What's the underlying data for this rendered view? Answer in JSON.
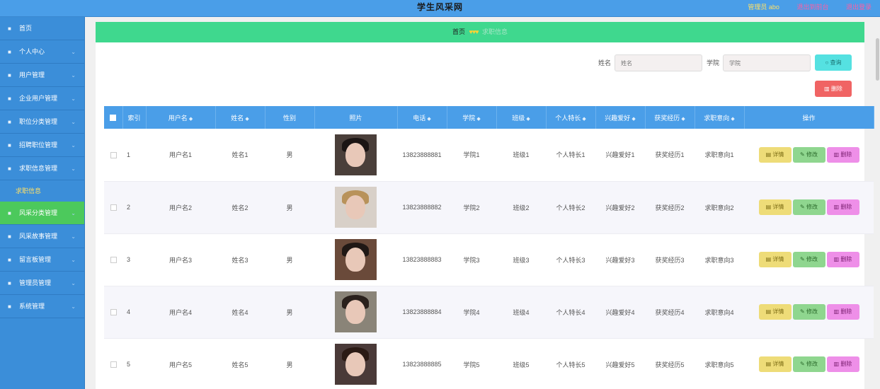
{
  "header": {
    "title": "学生风采网",
    "admin_label": "管理员 abo",
    "back_link": "退出到前台",
    "logout_link": "退出登录"
  },
  "sidebar": {
    "items": [
      {
        "label": "首页",
        "icon": "home-icon"
      },
      {
        "label": "个人中心",
        "icon": "user-icon"
      },
      {
        "label": "用户管理",
        "icon": "send-icon"
      },
      {
        "label": "企业用户管理",
        "icon": "copy-icon"
      },
      {
        "label": "职位分类管理",
        "icon": "compass-icon"
      },
      {
        "label": "招聘职位管理",
        "icon": "clock-icon"
      },
      {
        "label": "求职信息管理",
        "icon": "shield-icon"
      },
      {
        "label": "求职信息",
        "icon": "",
        "sub": true
      },
      {
        "label": "风采分类管理",
        "icon": "compass-icon",
        "active": true
      },
      {
        "label": "风采故事管理",
        "icon": "user-icon"
      },
      {
        "label": "留言板管理",
        "icon": "list-icon"
      },
      {
        "label": "管理员管理",
        "icon": "folder-icon"
      },
      {
        "label": "系统管理",
        "icon": "grid-icon"
      }
    ]
  },
  "breadcrumb": {
    "home": "首页",
    "separator": "♥♥♥",
    "current": "求职信息"
  },
  "search": {
    "name_label": "姓名",
    "name_placeholder": "姓名",
    "college_label": "学院",
    "college_placeholder": "学院",
    "query_button": "查询",
    "bulk_delete_button": "删除"
  },
  "table": {
    "columns": [
      "索引",
      "用户名",
      "姓名",
      "性别",
      "照片",
      "电话",
      "学院",
      "班级",
      "个人特长",
      "兴趣爱好",
      "获奖经历",
      "求职意向",
      "操作"
    ],
    "rows": [
      {
        "index": "1",
        "username": "用户名1",
        "name": "姓名1",
        "gender": "男",
        "phone": "13823888881",
        "college": "学院1",
        "class": "班级1",
        "specialty": "个人特长1",
        "hobby": "兴趣爱好1",
        "awards": "获奖经历1",
        "intention": "求职意向1"
      },
      {
        "index": "2",
        "username": "用户名2",
        "name": "姓名2",
        "gender": "男",
        "phone": "13823888882",
        "college": "学院2",
        "class": "班级2",
        "specialty": "个人特长2",
        "hobby": "兴趣爱好2",
        "awards": "获奖经历2",
        "intention": "求职意向2"
      },
      {
        "index": "3",
        "username": "用户名3",
        "name": "姓名3",
        "gender": "男",
        "phone": "13823888883",
        "college": "学院3",
        "class": "班级3",
        "specialty": "个人特长3",
        "hobby": "兴趣爱好3",
        "awards": "获奖经历3",
        "intention": "求职意向3"
      },
      {
        "index": "4",
        "username": "用户名4",
        "name": "姓名4",
        "gender": "男",
        "phone": "13823888884",
        "college": "学院4",
        "class": "班级4",
        "specialty": "个人特长4",
        "hobby": "兴趣爱好4",
        "awards": "获奖经历4",
        "intention": "求职意向4"
      },
      {
        "index": "5",
        "username": "用户名5",
        "name": "姓名5",
        "gender": "男",
        "phone": "13823888885",
        "college": "学院5",
        "class": "班级5",
        "specialty": "个人特长5",
        "hobby": "兴趣爱好5",
        "awards": "获奖经历5",
        "intention": "求职意向5"
      }
    ],
    "actions": {
      "detail": "详情",
      "edit": "修改",
      "delete": "删除"
    }
  },
  "colors": {
    "header_bg": "#4a9ee8",
    "sidebar_bg": "#3b8ed9",
    "sidebar_active": "#4cc95c",
    "breadcrumb_bg": "#3fd88e",
    "query_button": "#55e1e1",
    "delete_button": "#f06464",
    "detail_button": "#eedc78",
    "edit_button": "#8fd68f",
    "row_delete_button": "#ee8fe8"
  }
}
